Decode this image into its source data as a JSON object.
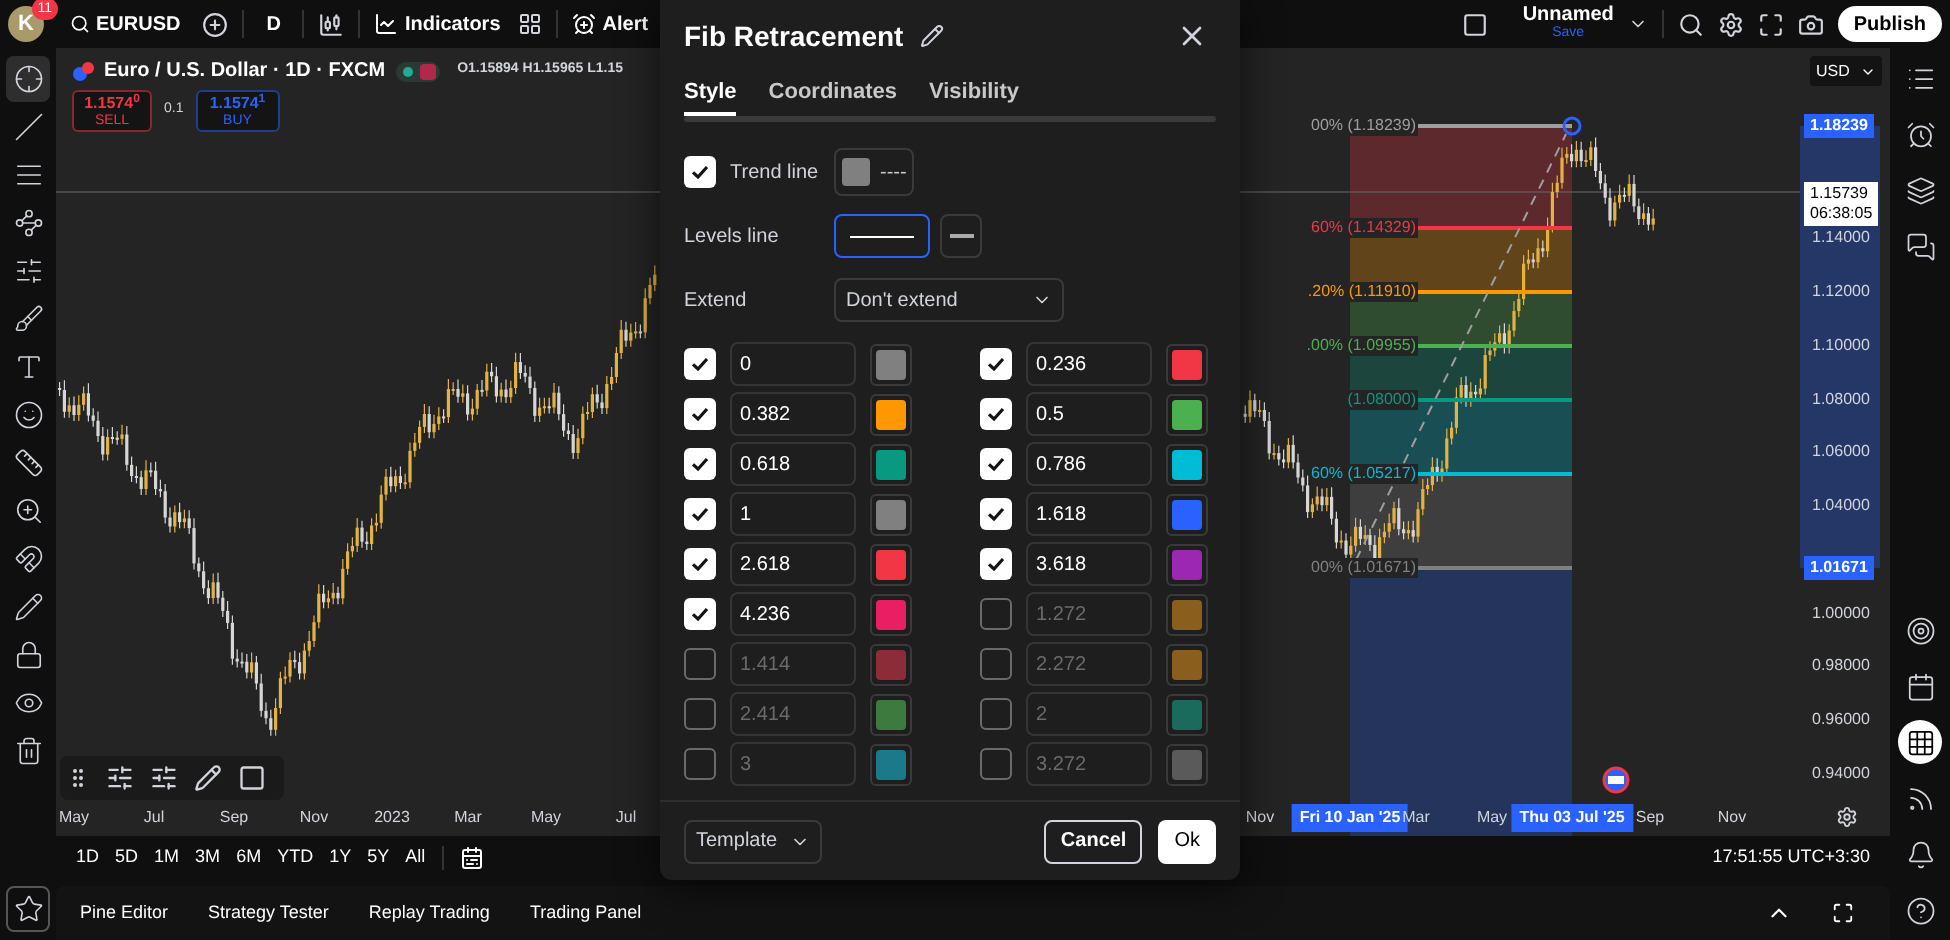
{
  "top_bar": {
    "avatar_letter": "K",
    "notification_count": "11",
    "symbol": "EURUSD",
    "interval": "D",
    "indicators": "Indicators",
    "alert": "Alert",
    "layout_name": "Unnamed",
    "save": "Save",
    "publish": "Publish"
  },
  "left_toolbar": [
    {
      "kind": "crosshair",
      "selected": true
    },
    {
      "kind": "trend",
      "selected": false
    },
    {
      "kind": "fib",
      "selected": false
    },
    {
      "kind": "pattern",
      "selected": false
    },
    {
      "kind": "channel",
      "selected": false
    },
    {
      "kind": "brush",
      "selected": false
    },
    {
      "kind": "text",
      "selected": false
    },
    {
      "kind": "emoji",
      "selected": false
    },
    {
      "kind": "ruler",
      "selected": false
    },
    {
      "kind": "zoom",
      "selected": false
    },
    {
      "kind": "magnet",
      "selected": false
    },
    {
      "kind": "pencil",
      "selected": false
    },
    {
      "kind": "lock",
      "selected": false
    },
    {
      "kind": "eye",
      "selected": false
    },
    {
      "kind": "trash",
      "selected": false
    },
    {
      "kind": "star",
      "selected": false
    }
  ],
  "chart_header": {
    "title": "Euro / U.S. Dollar · 1D · FXCM",
    "ohlc": "O1.15894 H1.15965 L1.15",
    "sell_price": "1.1574$^{0}$",
    "sell_label": "SELL",
    "spread": "0.1",
    "buy_price": "1.1574$^{1}$",
    "buy_label": "BUY"
  },
  "fib_labels": [
    {
      "text": "00% (1.18239)",
      "color": "#9e9e9e"
    },
    {
      "text": "60% (1.14329)",
      "color": "#f23645"
    },
    {
      "text": ".20% (1.11910)",
      "color": "#ff9800"
    },
    {
      "text": ".00% (1.09955)",
      "color": "#4caf50"
    },
    {
      "text": "(1.08000)",
      "color": "#089981"
    },
    {
      "text": "60% (1.05217)",
      "color": "#00bcd4"
    },
    {
      "text": "00% (1.01671)",
      "color": "#808080"
    }
  ],
  "price_axis": {
    "currency": "USD",
    "top_marker": "1.18239",
    "last_price": "1.15739",
    "countdown": "06:38:05",
    "bottom_marker": "1.01671",
    "ticks": [
      "1.14000",
      "1.12000",
      "1.10000",
      "1.08000",
      "1.06000",
      "1.04000",
      "1.00000",
      "0.98000",
      "0.96000",
      "0.94000"
    ]
  },
  "time_axis": [
    {
      "text": "May",
      "kind": "tick"
    },
    {
      "text": "Jul",
      "kind": "tick"
    },
    {
      "text": "Sep",
      "kind": "tick"
    },
    {
      "text": "Nov",
      "kind": "tick"
    },
    {
      "text": "2023",
      "kind": "tick"
    },
    {
      "text": "Mar",
      "kind": "tick"
    },
    {
      "text": "May",
      "kind": "tick"
    },
    {
      "text": "Jul",
      "kind": "tick"
    },
    {
      "text": "Nov",
      "kind": "tick"
    },
    {
      "text": "Fri 10 Jan '25",
      "kind": "marker"
    },
    {
      "text": "Mar",
      "kind": "tick"
    },
    {
      "text": "May",
      "kind": "tick"
    },
    {
      "text": "Thu 03 Jul '25",
      "kind": "marker"
    },
    {
      "text": "Sep",
      "kind": "tick"
    },
    {
      "text": "Nov",
      "kind": "tick"
    }
  ],
  "ranges": [
    "1D",
    "5D",
    "1M",
    "3M",
    "6M",
    "YTD",
    "1Y",
    "5Y",
    "All"
  ],
  "clock": "17:51:55 UTC+3:30",
  "bottom_tabs": [
    "Pine Editor",
    "Strategy Tester",
    "Replay Trading",
    "Trading Panel"
  ],
  "right_toolbar": [
    {
      "kind": "watchlist",
      "selected": false
    },
    {
      "kind": "alarm",
      "selected": false
    },
    {
      "kind": "layers",
      "selected": false
    },
    {
      "kind": "chat",
      "selected": false
    },
    {
      "kind": "target",
      "selected": false
    },
    {
      "kind": "calendar",
      "selected": false
    },
    {
      "kind": "apps",
      "selected": true
    },
    {
      "kind": "broadcast",
      "selected": false
    },
    {
      "kind": "bell",
      "selected": false
    },
    {
      "kind": "help",
      "selected": false
    }
  ],
  "dialog": {
    "title": "Fib Retracement",
    "tabs": [
      {
        "label": "Style",
        "selected": true
      },
      {
        "label": "Coordinates",
        "selected": false
      },
      {
        "label": "Visibility",
        "selected": false
      }
    ],
    "trend_line": {
      "label": "Trend line",
      "checked": true,
      "color": "#808080",
      "style": "----"
    },
    "levels_line": {
      "label": "Levels line"
    },
    "extend": {
      "label": "Extend",
      "value": "Don't extend"
    },
    "levels": [
      {
        "value": "0",
        "checked": true,
        "color": "#808080"
      },
      {
        "value": "0.236",
        "checked": true,
        "color": "#f23645"
      },
      {
        "value": "0.382",
        "checked": true,
        "color": "#ff9800"
      },
      {
        "value": "0.5",
        "checked": true,
        "color": "#4caf50"
      },
      {
        "value": "0.618",
        "checked": true,
        "color": "#089981"
      },
      {
        "value": "0.786",
        "checked": true,
        "color": "#00bcd4"
      },
      {
        "value": "1",
        "checked": true,
        "color": "#808080"
      },
      {
        "value": "1.618",
        "checked": true,
        "color": "#2962ff"
      },
      {
        "value": "2.618",
        "checked": true,
        "color": "#f23645"
      },
      {
        "value": "3.618",
        "checked": true,
        "color": "#9c27b0"
      },
      {
        "value": "4.236",
        "checked": true,
        "color": "#e91e63"
      },
      {
        "value": "1.272",
        "checked": false,
        "color": "#8a5e1c"
      },
      {
        "value": "1.414",
        "checked": false,
        "color": "#8b2c38"
      },
      {
        "value": "2.272",
        "checked": false,
        "color": "#8a5e1c"
      },
      {
        "value": "2.414",
        "checked": false,
        "color": "#3d7a3d"
      },
      {
        "value": "2",
        "checked": false,
        "color": "#1a6b5c"
      },
      {
        "value": "3",
        "checked": false,
        "color": "#1a7a8a"
      },
      {
        "value": "3.272",
        "checked": false,
        "color": "#5a5a5a"
      }
    ],
    "template": "Template",
    "cancel": "Cancel",
    "ok": "Ok"
  }
}
